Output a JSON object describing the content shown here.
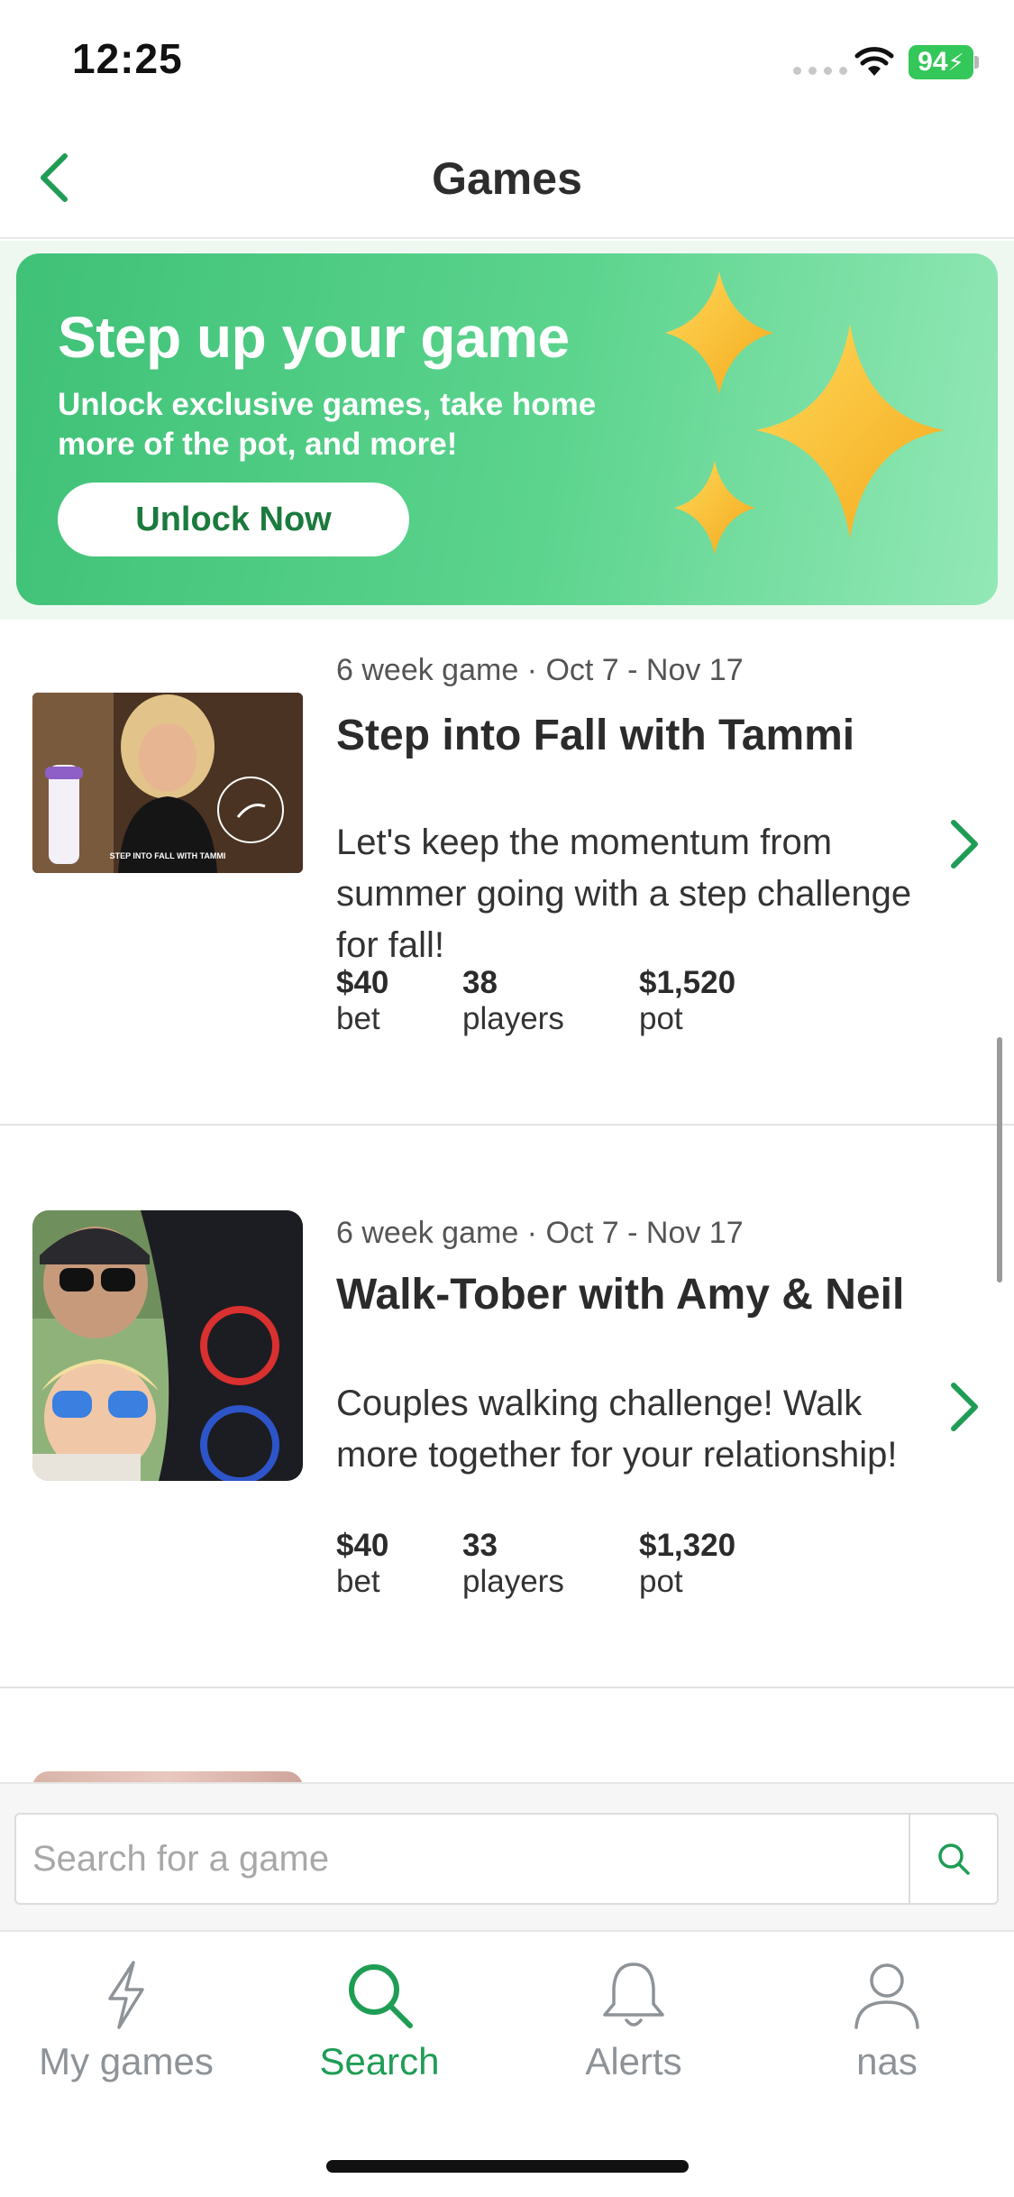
{
  "status_bar": {
    "time": "12:25",
    "battery": "94"
  },
  "nav": {
    "title": "Games",
    "back_icon": "chevron-left-icon"
  },
  "promo": {
    "title": "Step up your game",
    "subtitle": "Unlock exclusive games, take home more of the pot, and more!",
    "button_label": "Unlock Now",
    "icon": "sparkle-icon"
  },
  "games": [
    {
      "meta": "6 week game · Oct 7 - Nov 17",
      "title": "Step into Fall with Tammi",
      "description": "Let's keep the momentum from summer going with a step challenge for fall!",
      "thumb_caption": "STEP INTO FALL WITH TAMMI",
      "stats": [
        {
          "value": "$40",
          "label": "bet"
        },
        {
          "value": "38",
          "label": "players"
        },
        {
          "value": "$1,520",
          "label": "pot"
        }
      ]
    },
    {
      "meta": "6 week game · Oct 7 - Nov 17",
      "title": "Walk-Tober with Amy & Neil",
      "description": "Couples walking challenge! Walk more together for your relationship!",
      "stats": [
        {
          "value": "$40",
          "label": "bet"
        },
        {
          "value": "33",
          "label": "players"
        },
        {
          "value": "$1,320",
          "label": "pot"
        }
      ]
    }
  ],
  "search": {
    "placeholder": "Search for a game",
    "icon": "search-icon"
  },
  "tabs": [
    {
      "label": "My games",
      "icon": "lightning-icon"
    },
    {
      "label": "Search",
      "icon": "search-icon",
      "active": true
    },
    {
      "label": "Alerts",
      "icon": "bell-icon"
    },
    {
      "label": "nas",
      "icon": "user-icon"
    }
  ],
  "colors": {
    "accent": "#1f9d55",
    "banner": "#4cc982",
    "tab_inactive": "#8e9398"
  }
}
